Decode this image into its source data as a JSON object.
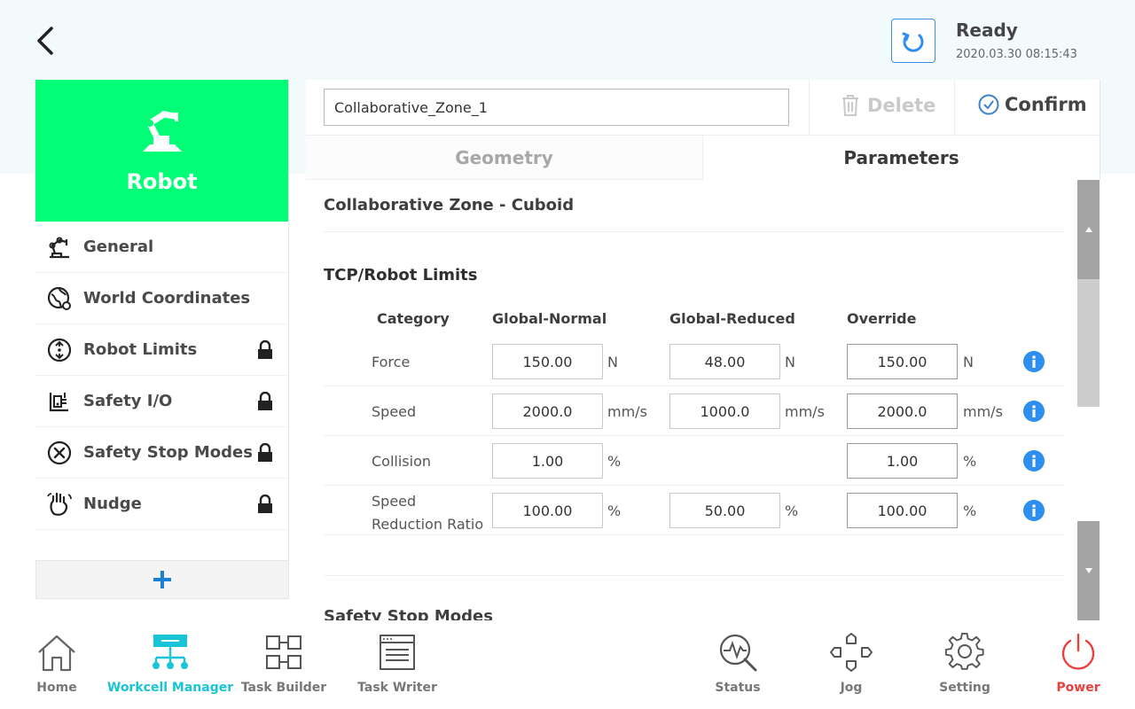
{
  "header": {
    "status": "Ready",
    "timestamp": "2020.03.30 08:15:43",
    "icons": {
      "back": "chevron-left-icon",
      "status": "refresh-arrow-icon"
    }
  },
  "sidebar": {
    "card_title": "Robot",
    "items": [
      {
        "label": "General",
        "icon": "robot-arm-icon",
        "locked": false
      },
      {
        "label": "World Coordinates",
        "icon": "globe-pin-icon",
        "locked": false
      },
      {
        "label": "Robot Limits",
        "icon": "limit-circle-icon",
        "locked": true
      },
      {
        "label": "Safety I/O",
        "icon": "io-panel-icon",
        "locked": true
      },
      {
        "label": "Safety Stop Modes",
        "icon": "stop-x-circle-icon",
        "locked": true
      },
      {
        "label": "Nudge",
        "icon": "hand-icon",
        "locked": true
      }
    ],
    "add_icon": "plus-icon"
  },
  "editor": {
    "zone_name": "Collaborative_Zone_1",
    "delete_label": "Delete",
    "confirm_label": "Confirm",
    "tabs": [
      "Geometry",
      "Parameters"
    ],
    "active_tab": "Parameters",
    "zone_title": "Collaborative Zone - Cuboid",
    "section_title": "TCP/Robot Limits",
    "columns": [
      "Category",
      "Global-Normal",
      "Global-Reduced",
      "Override"
    ],
    "rows": [
      {
        "category": "Force",
        "normal": "150.00",
        "normal_unit": "N",
        "reduced": "48.00",
        "reduced_unit": "N",
        "override": "150.00",
        "override_unit": "N"
      },
      {
        "category": "Speed",
        "normal": "2000.0",
        "normal_unit": "mm/s",
        "reduced": "1000.0",
        "reduced_unit": "mm/s",
        "override": "2000.0",
        "override_unit": "mm/s"
      },
      {
        "category": "Collision",
        "normal": "1.00",
        "normal_unit": "%",
        "reduced": "",
        "reduced_unit": "",
        "override": "1.00",
        "override_unit": "%"
      },
      {
        "category": "Speed Reduction Ratio",
        "normal": "100.00",
        "normal_unit": "%",
        "reduced": "50.00",
        "reduced_unit": "%",
        "override": "100.00",
        "override_unit": "%"
      }
    ],
    "next_section": "Safety Stop Modes"
  },
  "nav": [
    {
      "label": "Home",
      "icon": "home-icon"
    },
    {
      "label": "Workcell Manager",
      "icon": "workcell-icon",
      "active": true
    },
    {
      "label": "Task Builder",
      "icon": "task-builder-icon"
    },
    {
      "label": "Task Writer",
      "icon": "task-writer-icon"
    },
    {
      "label": "Status",
      "icon": "status-magnifier-icon"
    },
    {
      "label": "Jog",
      "icon": "jog-arrows-icon"
    },
    {
      "label": "Setting",
      "icon": "gear-icon"
    },
    {
      "label": "Power",
      "icon": "power-icon"
    }
  ],
  "colors": {
    "accent_green": "#00ff76",
    "active_nav": "#19c4d8",
    "power": "#e9413f",
    "info_blue": "#2d8fef"
  }
}
